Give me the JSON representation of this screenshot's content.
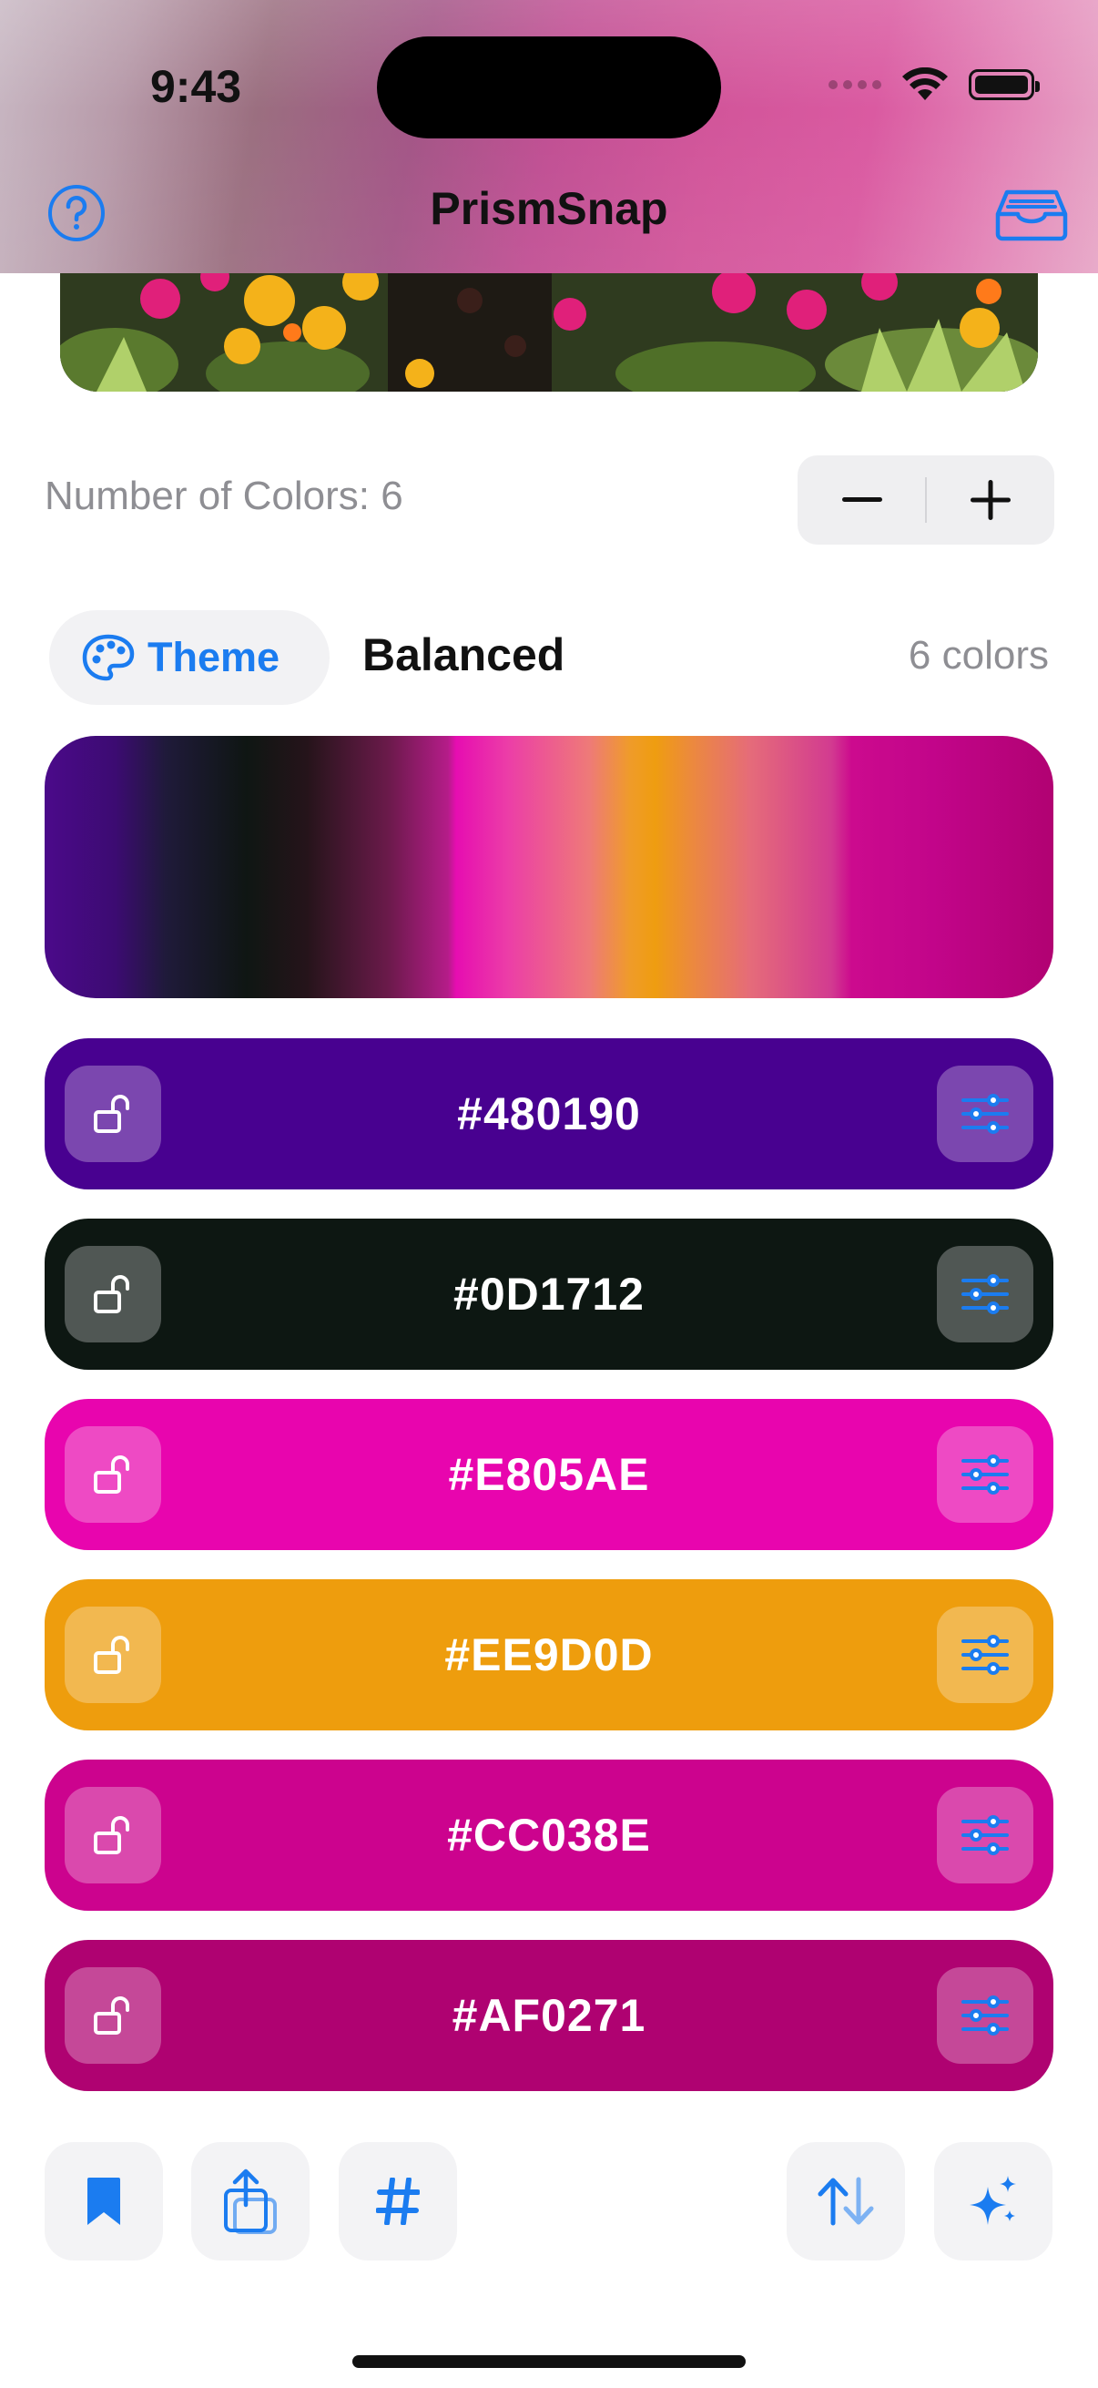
{
  "status_bar": {
    "time": "9:43"
  },
  "nav": {
    "title": "PrismSnap"
  },
  "colors_count": {
    "label": "Number of Colors: 6"
  },
  "theme": {
    "button_label": "Theme",
    "name": "Balanced",
    "count_label": "6 colors"
  },
  "swatches": [
    {
      "hex": "#480190",
      "color": "#480190",
      "locked": false
    },
    {
      "hex": "#0D1712",
      "color": "#0D1712",
      "locked": false
    },
    {
      "hex": "#E805AE",
      "color": "#E805AE",
      "locked": false
    },
    {
      "hex": "#EE9D0D",
      "color": "#EE9D0D",
      "locked": false
    },
    {
      "hex": "#CC038E",
      "color": "#CC038E",
      "locked": false
    },
    {
      "hex": "#AF0271",
      "color": "#AF0271",
      "locked": false
    }
  ],
  "accent_color": "#1B7CF0",
  "toolbar": {
    "items": [
      "bookmark-icon",
      "share-icon",
      "hashtag-icon",
      "sort-icon",
      "sparkles-icon"
    ]
  }
}
